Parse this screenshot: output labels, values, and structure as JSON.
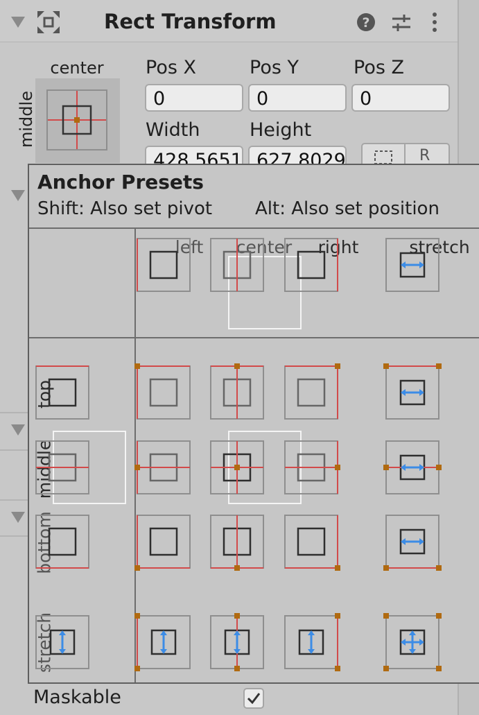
{
  "component": {
    "title": "Rect Transform",
    "anchor_preview": {
      "horizontal": "center",
      "vertical": "middle"
    },
    "fields": [
      {
        "label": "Pos X",
        "value": "0"
      },
      {
        "label": "Pos Y",
        "value": "0"
      },
      {
        "label": "Pos Z",
        "value": "0"
      },
      {
        "label": "Width",
        "value": "428.5651"
      },
      {
        "label": "Height",
        "value": "627.8029"
      }
    ],
    "raw_edit_label": "R",
    "icons": [
      "component-icon",
      "help-icon",
      "preset-icon",
      "more-icon"
    ]
  },
  "popup": {
    "title": "Anchor Presets",
    "hint_shift": "Shift: Also set pivot",
    "hint_alt": "Alt: Also set position",
    "columns": [
      "left",
      "center",
      "right",
      "stretch"
    ],
    "rows": [
      "top",
      "middle",
      "bottom",
      "stretch"
    ],
    "selected": {
      "column": "center",
      "row": "middle"
    }
  },
  "below": {
    "maskable_label": "Maskable",
    "maskable_checked": true
  },
  "colors": {
    "anchor_line": "#d24a4a",
    "anchor_dot": "#b06a10",
    "stretch_arrow": "#3c8ce6",
    "panel_bg": "#c8c8c8"
  }
}
